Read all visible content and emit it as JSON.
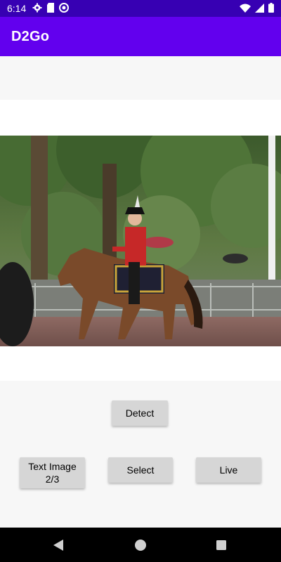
{
  "status_bar": {
    "time": "6:14",
    "left_icons": [
      "gear-icon",
      "sd-card-icon",
      "do-not-disturb-icon"
    ],
    "right_icons": [
      "wifi-icon",
      "signal-icon",
      "battery-icon"
    ]
  },
  "app_bar": {
    "title": "D2Go"
  },
  "image": {
    "description_name": "detection-input-image"
  },
  "buttons": {
    "detect": "Detect",
    "text_image": {
      "line1": "Text Image",
      "line2": "2/3"
    },
    "select": "Select",
    "live": "Live"
  },
  "nav_bar": {
    "icons": [
      "back-icon",
      "home-icon",
      "recents-icon"
    ]
  },
  "colors": {
    "status_bar": "#3700b3",
    "app_bar": "#6200ee",
    "button_bg": "#d6d6d6"
  }
}
